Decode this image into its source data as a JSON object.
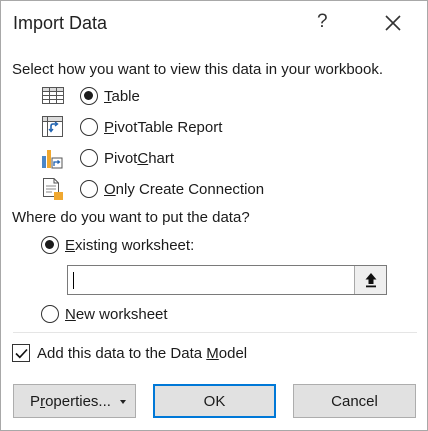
{
  "dialog": {
    "title": "Import Data",
    "help_label": "?",
    "prompt": "Select how you want to view this data in your workbook.",
    "view_options": [
      {
        "pre": "",
        "ul": "T",
        "post": "able",
        "selected": true,
        "icon": "table-icon"
      },
      {
        "pre": "",
        "ul": "P",
        "post": "ivotTable Report",
        "selected": false,
        "icon": "pivottable-icon"
      },
      {
        "pre": "Pivot",
        "ul": "C",
        "post": "hart",
        "selected": false,
        "icon": "pivotchart-icon"
      },
      {
        "pre": "",
        "ul": "O",
        "post": "nly Create Connection",
        "selected": false,
        "icon": "connection-icon"
      }
    ],
    "where_prompt": "Where do you want to put the data?",
    "existing": {
      "ul": "E",
      "post": "xisting worksheet:",
      "selected": true
    },
    "range_value": "",
    "new": {
      "ul": "N",
      "post": "ew worksheet",
      "selected": false
    },
    "data_model": {
      "pre": "Add this data to the Data ",
      "ul": "M",
      "post": "odel",
      "checked": true
    },
    "buttons": {
      "properties": {
        "pre": "P",
        "ul": "r",
        "post": "operties..."
      },
      "ok": "OK",
      "cancel": "Cancel"
    },
    "colors": {
      "accent": "#0078d7",
      "button_bg": "#e1e1e1"
    }
  }
}
